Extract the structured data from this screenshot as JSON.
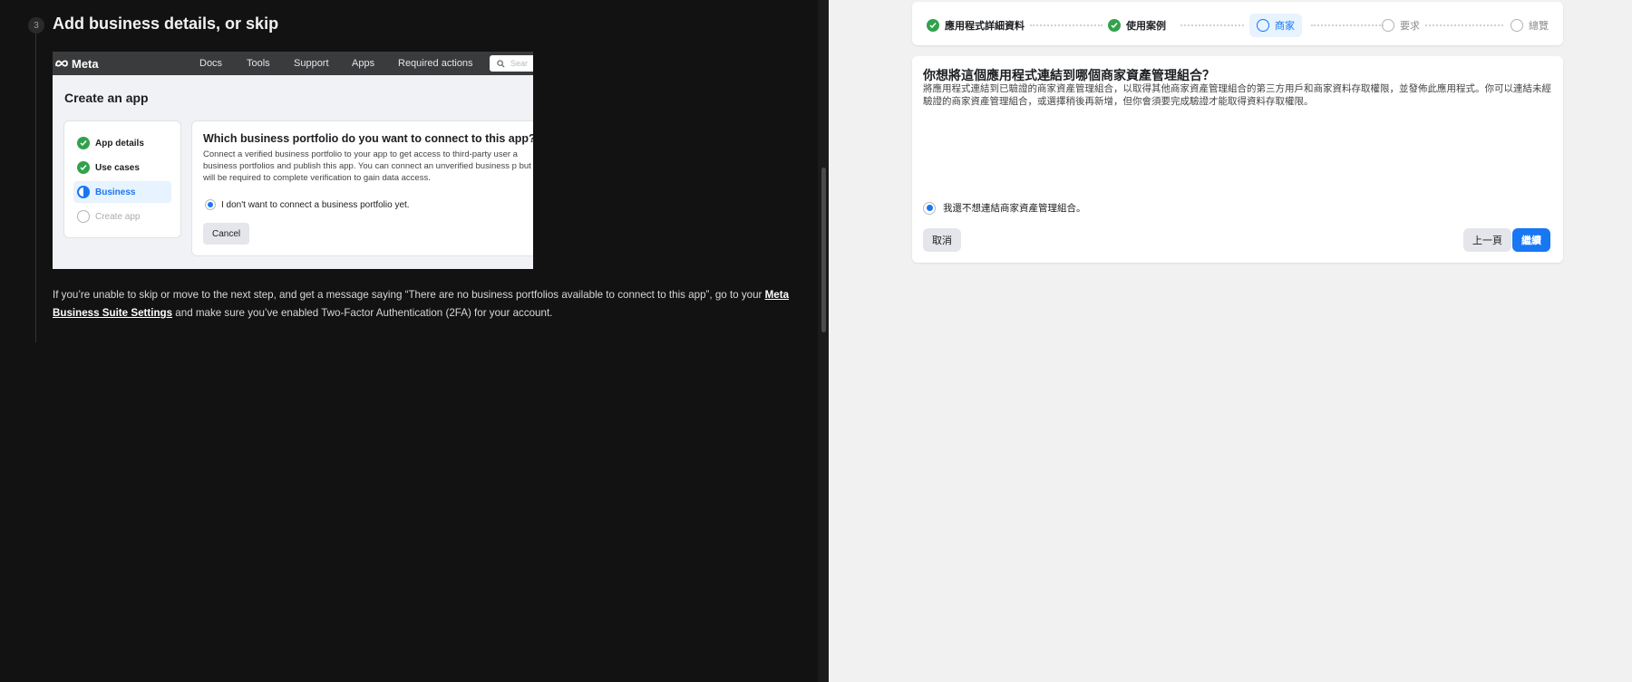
{
  "docs": {
    "step_number": "3",
    "step_title": "Add business details, or skip",
    "embedded": {
      "logo_text": "Meta",
      "nav": [
        "Docs",
        "Tools",
        "Support",
        "Apps",
        "Required actions"
      ],
      "search_placeholder": "Sear",
      "page_title": "Create an app",
      "sidebar": [
        {
          "label": "App details",
          "state": "done"
        },
        {
          "label": "Use cases",
          "state": "done"
        },
        {
          "label": "Business",
          "state": "current"
        },
        {
          "label": "Create app",
          "state": "todo"
        }
      ],
      "card_title": "Which business portfolio do you want to connect to this app?",
      "card_desc": "Connect a verified business portfolio to your app to get access to third-party user a business portfolios and publish this app. You can connect an unverified business p but will be required to complete verification to gain data access.",
      "radio_label": "I don't want to connect a business portfolio yet.",
      "cancel": "Cancel"
    },
    "help": {
      "before": "If you’re unable to skip or move to the next step, and get a message saying “There are no business portfolios available to connect to this app”, go to your ",
      "link": "Meta Business Suite Settings",
      "after": " and make sure you’ve enabled Two-Factor Authentication (2FA) for your account."
    }
  },
  "wizard": {
    "steps": [
      {
        "label": "應用程式詳細資料",
        "state": "done"
      },
      {
        "label": "使用案例",
        "state": "done"
      },
      {
        "label": "商家",
        "state": "current"
      },
      {
        "label": "要求",
        "state": "todo"
      },
      {
        "label": "總覽",
        "state": "todo"
      }
    ],
    "title": "你想將這個應用程式連結到哪個商家資產管理組合？",
    "description": "將應用程式連結到已驗證的商家資產管理組合，以取得其他商家資產管理組合的第三方用戶和商家資料存取權限，並發佈此應用程式。你可以連結未經驗證的商家資產管理組合，或選擇稍後再新增，但你會須要完成驗證才能取得資料存取權限。",
    "radio_label": "我還不想連結商家資產管理組合。",
    "cancel": "取消",
    "back": "上一頁",
    "continue": "繼續"
  },
  "colors": {
    "accent": "#1877f2",
    "done": "#31a24c",
    "dark_bg": "#121212"
  }
}
